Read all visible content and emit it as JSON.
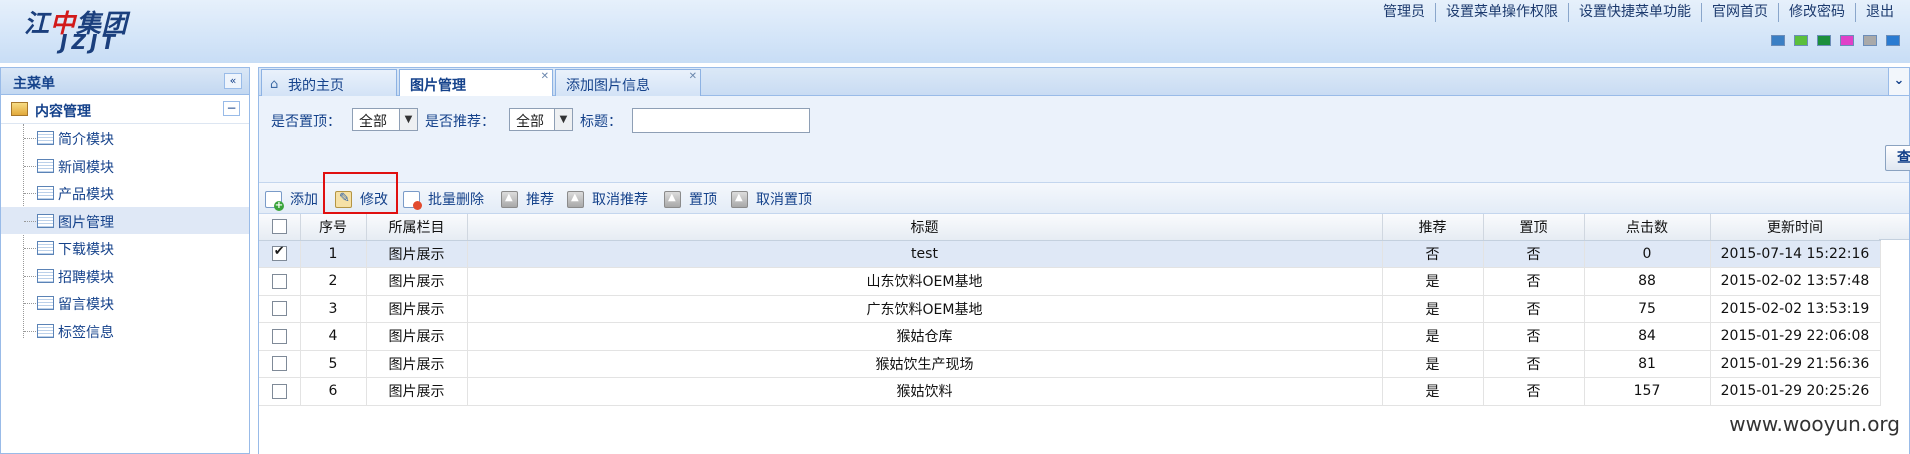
{
  "header": {
    "logo_cn": "江中集团",
    "logo_en": "JZJT",
    "links": [
      "管理员",
      "设置菜单操作权限",
      "设置快捷菜单功能",
      "官网首页",
      "修改密码",
      "退出"
    ],
    "swatches": [
      "#3b7fc4",
      "#5bbf3c",
      "#1c8f3c",
      "#e040c8",
      "#a9a9a9",
      "#2a7bd1"
    ]
  },
  "sidebar": {
    "title": "主菜单",
    "group": "内容管理",
    "items": [
      {
        "label": "简介模块"
      },
      {
        "label": "新闻模块"
      },
      {
        "label": "产品模块"
      },
      {
        "label": "图片管理",
        "active": true
      },
      {
        "label": "下载模块"
      },
      {
        "label": "招聘模块"
      },
      {
        "label": "留言模块"
      },
      {
        "label": "标签信息"
      }
    ]
  },
  "tabs": [
    {
      "label": "我的主页"
    },
    {
      "label": "图片管理",
      "active": true
    },
    {
      "label": "添加图片信息"
    }
  ],
  "filter": {
    "top_label": "是否置顶：",
    "top_value": "全部",
    "rec_label": "是否推荐：",
    "rec_value": "全部",
    "title_label": "标题：",
    "title_value": "",
    "query_label": "查询"
  },
  "toolbar": {
    "add": "添加",
    "edit": "修改",
    "batch_delete": "批量删除",
    "recommend": "推荐",
    "cancel_recommend": "取消推荐",
    "top": "置顶",
    "cancel_top": "取消置顶"
  },
  "table": {
    "columns": [
      "序号",
      "所属栏目",
      "标题",
      "推荐",
      "置顶",
      "点击数",
      "更新时间"
    ],
    "rows": [
      {
        "checked": true,
        "no": "1",
        "column": "图片展示",
        "title": "test",
        "rec": "否",
        "top": "否",
        "clicks": "0",
        "updated": "2015-07-14 15:22:16"
      },
      {
        "checked": false,
        "no": "2",
        "column": "图片展示",
        "title": "山东饮料OEM基地",
        "rec": "是",
        "top": "否",
        "clicks": "88",
        "updated": "2015-02-02 13:57:48"
      },
      {
        "checked": false,
        "no": "3",
        "column": "图片展示",
        "title": "广东饮料OEM基地",
        "rec": "是",
        "top": "否",
        "clicks": "75",
        "updated": "2015-02-02 13:53:19"
      },
      {
        "checked": false,
        "no": "4",
        "column": "图片展示",
        "title": "猴姑仓库",
        "rec": "是",
        "top": "否",
        "clicks": "84",
        "updated": "2015-01-29 22:06:08"
      },
      {
        "checked": false,
        "no": "5",
        "column": "图片展示",
        "title": "猴姑饮生产现场",
        "rec": "是",
        "top": "否",
        "clicks": "81",
        "updated": "2015-01-29 21:56:36"
      },
      {
        "checked": false,
        "no": "6",
        "column": "图片展示",
        "title": "猴姑饮料",
        "rec": "是",
        "top": "否",
        "clicks": "157",
        "updated": "2015-01-29 20:25:26"
      }
    ]
  },
  "watermark": "www.wooyun.org"
}
